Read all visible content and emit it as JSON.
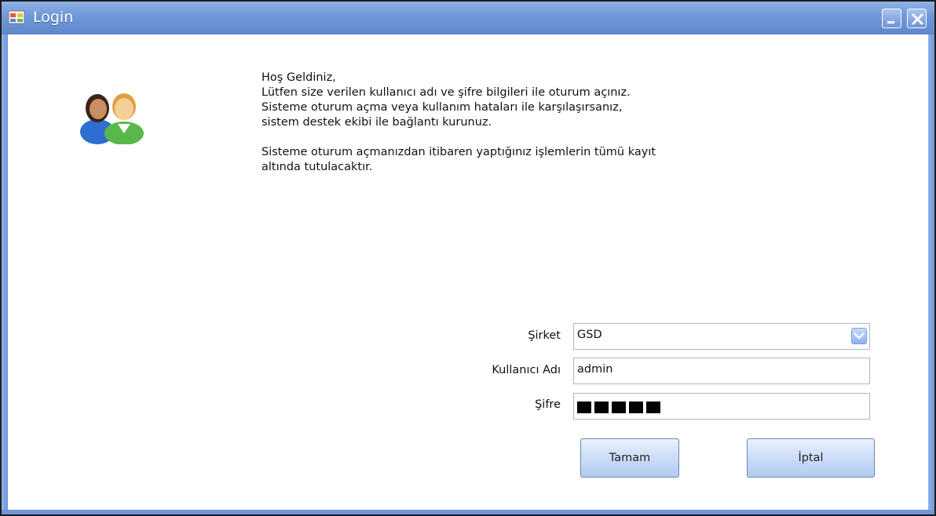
{
  "window": {
    "title": "Login"
  },
  "message": {
    "lines_block1": [
      "Hoş Geldiniz,",
      "Lütfen size verilen kullanıcı adı ve şifre bilgileri ile oturum açınız.",
      "Sisteme oturum açma veya kullanım hataları ile karşılaşırsanız,",
      "sistem destek ekibi ile bağlantı kurunuz."
    ],
    "lines_block2": [
      "Sisteme oturum açmanızdan itibaren yaptığınız işlemlerin tümü kayıt",
      "altında tutulacaktır."
    ]
  },
  "form": {
    "company_label": "Şirket",
    "company_value": "GSD",
    "username_label": "Kullanıcı Adı",
    "username_value": "admin",
    "password_label": "Şifre",
    "password_masked_length": 5
  },
  "buttons": {
    "ok_label": "Tamam",
    "cancel_label": "İptal"
  },
  "icons": {
    "app_icon": "window-app-icon",
    "users_icon": "users-icon",
    "minimize_icon": "minimize-icon",
    "close_icon": "close-icon",
    "dropdown_icon": "chevron-down-icon"
  },
  "colors": {
    "titlebar": "#6f97d8",
    "button_face": "#c9dbf7"
  }
}
